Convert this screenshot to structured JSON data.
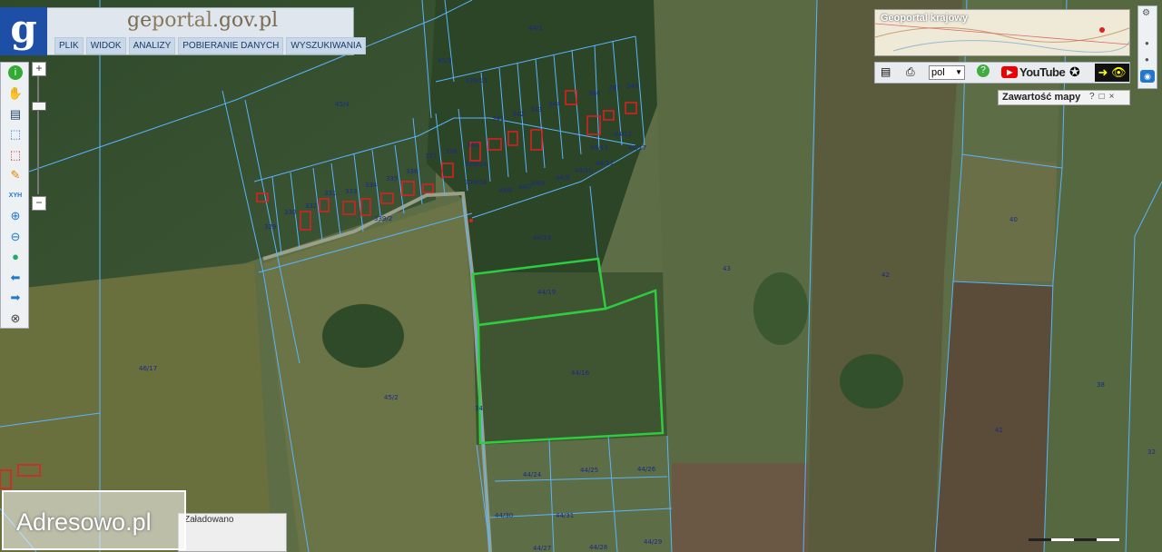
{
  "header": {
    "logo_letter": "g",
    "brand_prefix": "ge",
    "brand_mid": "portal",
    "brand_suffix": ".gov.pl",
    "menu": [
      "PLIK",
      "WIDOK",
      "ANALIZY",
      "POBIERANIE DANYCH",
      "WYSZUKIWANIA"
    ]
  },
  "toolbar": {
    "tools": [
      "info-icon",
      "pan-hand-icon",
      "layers-list-icon",
      "select-icon",
      "select-area-icon",
      "edit-pencil-icon",
      "xyh-coordinates-icon",
      "zoom-in-icon",
      "zoom-out-icon",
      "globe-icon",
      "back-arrow-icon",
      "forward-arrow-icon",
      "zoom-extent-icon"
    ],
    "xyh_label": "XYH",
    "zoom_plus": "+",
    "zoom_minus": "−"
  },
  "right": {
    "geoportal_label": "Geoportal krajowy",
    "language": "pol",
    "youtube_label": "YouTube",
    "panel_title": "Zawartość mapy",
    "panel_controls": [
      "?",
      "□",
      "×"
    ]
  },
  "bottom": {
    "watermark": "Adresowo.pl",
    "status": "Załadowano"
  },
  "map": {
    "colors": {
      "parcel_line": "#5ab4ff",
      "highlight": "#2ecc40",
      "building": "#e02020",
      "label": "#1a2a8a"
    },
    "parcel_labels": [
      "44/1",
      "45/3",
      "339/13",
      "45/4",
      "346",
      "347",
      "348",
      "343",
      "344",
      "342",
      "341",
      "340",
      "339/14",
      "339/16",
      "338",
      "337",
      "336",
      "335",
      "334",
      "333",
      "332",
      "331",
      "330",
      "329",
      "339/2",
      "44/17",
      "44/8",
      "44/7",
      "44/6",
      "44/9",
      "44/10",
      "44/11",
      "44/12",
      "44/14",
      "44/18",
      "44/19",
      "44/16",
      "44/24",
      "44/25",
      "44/26",
      "44/30",
      "44/31",
      "44/27",
      "44/28",
      "44/29",
      "46/17",
      "45/2",
      "43",
      "42",
      "41",
      "40",
      "38",
      "34",
      "32"
    ]
  }
}
